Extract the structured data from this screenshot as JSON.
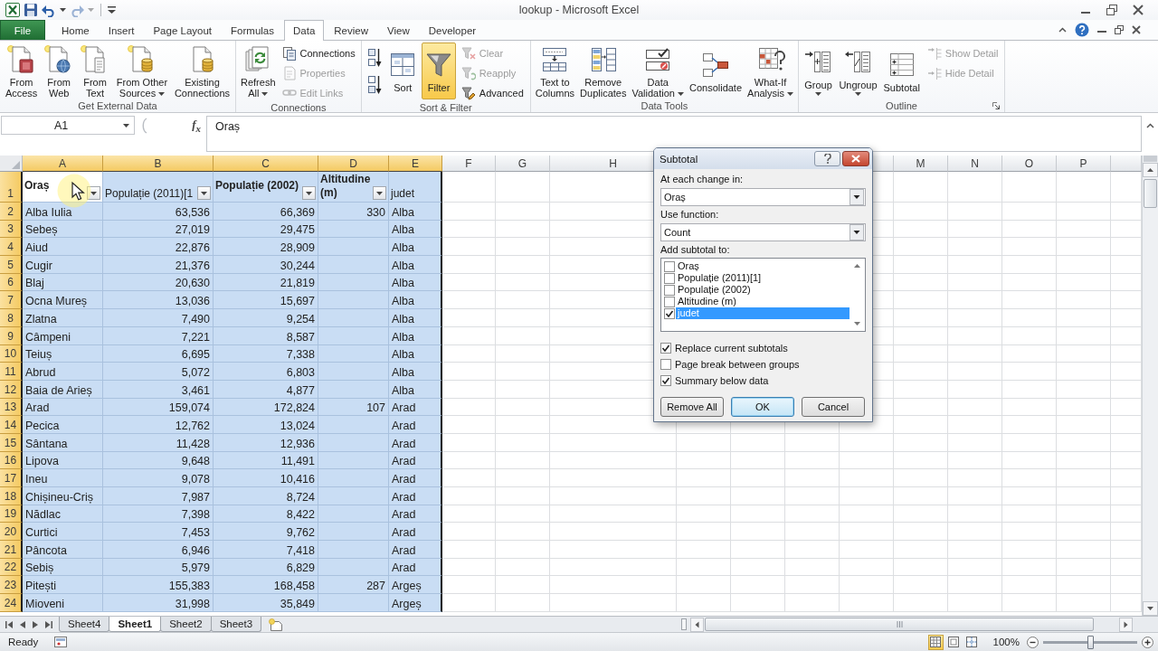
{
  "window": {
    "title": "lookup - Microsoft Excel"
  },
  "quick_access": [
    {
      "disabled": false
    },
    {
      "disabled": false
    },
    {
      "disabled": true
    }
  ],
  "ribbon_tabs": [
    {
      "label": "File",
      "kind": "file",
      "selected": false
    },
    {
      "label": "Home",
      "kind": "tab",
      "selected": false
    },
    {
      "label": "Insert",
      "kind": "tab",
      "selected": false
    },
    {
      "label": "Page Layout",
      "kind": "tab",
      "selected": false
    },
    {
      "label": "Formulas",
      "kind": "tab",
      "selected": false
    },
    {
      "label": "Data",
      "kind": "tab",
      "selected": true
    },
    {
      "label": "Review",
      "kind": "tab",
      "selected": false
    },
    {
      "label": "View",
      "kind": "tab",
      "selected": false
    },
    {
      "label": "Developer",
      "kind": "tab",
      "selected": false
    }
  ],
  "ribbon_groups": [
    {
      "label": "Get External Data",
      "launcher": false,
      "buttons": [
        {
          "kind": "large",
          "label": "From\nAccess",
          "dropdown": false,
          "disabled": false,
          "pressed": false
        },
        {
          "kind": "large",
          "label": "From\nWeb",
          "dropdown": false,
          "disabled": false,
          "pressed": false
        },
        {
          "kind": "large",
          "label": "From\nText",
          "dropdown": false,
          "disabled": false,
          "pressed": false
        },
        {
          "kind": "large",
          "label": "From Other\nSources",
          "dropdown": true,
          "disabled": false,
          "pressed": false
        },
        {
          "kind": "large",
          "label": "Existing\nConnections",
          "dropdown": false,
          "disabled": false,
          "pressed": false
        }
      ]
    },
    {
      "label": "Connections",
      "launcher": false,
      "buttons": [
        {
          "kind": "large",
          "label": "Refresh\nAll",
          "dropdown": true,
          "disabled": false,
          "pressed": false
        },
        {
          "kind": "small",
          "label": "Connections",
          "dropdown": false,
          "disabled": false,
          "pressed": false
        },
        {
          "kind": "small",
          "label": "Properties",
          "dropdown": false,
          "disabled": true,
          "pressed": false
        },
        {
          "kind": "small",
          "label": "Edit Links",
          "dropdown": false,
          "disabled": true,
          "pressed": false
        }
      ]
    },
    {
      "label": "Sort & Filter",
      "launcher": false,
      "buttons": [
        {
          "kind": "icon",
          "dropdown": false,
          "disabled": false,
          "pressed": false
        },
        {
          "kind": "icon",
          "dropdown": false,
          "disabled": false,
          "pressed": false
        },
        {
          "kind": "large",
          "label": "Sort",
          "dropdown": false,
          "disabled": false,
          "pressed": false
        },
        {
          "kind": "large",
          "label": "Filter",
          "dropdown": false,
          "disabled": false,
          "pressed": true
        },
        {
          "kind": "small",
          "label": "Clear",
          "dropdown": false,
          "disabled": true,
          "pressed": false
        },
        {
          "kind": "small",
          "label": "Reapply",
          "dropdown": false,
          "disabled": true,
          "pressed": false
        },
        {
          "kind": "small",
          "label": "Advanced",
          "dropdown": false,
          "disabled": false,
          "pressed": false
        }
      ]
    },
    {
      "label": "Data Tools",
      "launcher": false,
      "buttons": [
        {
          "kind": "large",
          "label": "Text to\nColumns",
          "dropdown": false,
          "disabled": false,
          "pressed": false
        },
        {
          "kind": "large",
          "label": "Remove\nDuplicates",
          "dropdown": false,
          "disabled": false,
          "pressed": false
        },
        {
          "kind": "large",
          "label": "Data\nValidation",
          "dropdown": true,
          "disabled": false,
          "pressed": false
        },
        {
          "kind": "large",
          "label": "Consolidate",
          "dropdown": false,
          "disabled": false,
          "pressed": false
        },
        {
          "kind": "large",
          "label": "What-If\nAnalysis",
          "dropdown": true,
          "disabled": false,
          "pressed": false
        }
      ]
    },
    {
      "label": "Outline",
      "launcher": true,
      "buttons": [
        {
          "kind": "large",
          "label": "Group",
          "dropdown": true,
          "disabled": false,
          "pressed": false
        },
        {
          "kind": "large",
          "label": "Ungroup",
          "dropdown": true,
          "disabled": false,
          "pressed": false
        },
        {
          "kind": "large",
          "label": "Subtotal",
          "dropdown": false,
          "disabled": false,
          "pressed": false
        },
        {
          "kind": "small",
          "label": "Show Detail",
          "dropdown": false,
          "disabled": true,
          "pressed": false
        },
        {
          "kind": "small",
          "label": "Hide Detail",
          "dropdown": false,
          "disabled": true,
          "pressed": false
        }
      ]
    }
  ],
  "formula_bar": {
    "name_box": "A1",
    "function_button": "f$_{x}$",
    "formula": "Oraș"
  },
  "sheet": {
    "columns": [
      {
        "letter": "A",
        "selected": true,
        "kind": "text"
      },
      {
        "letter": "B",
        "selected": true,
        "kind": "number"
      },
      {
        "letter": "C",
        "selected": true,
        "kind": "number"
      },
      {
        "letter": "D",
        "selected": true,
        "kind": "number"
      },
      {
        "letter": "E",
        "selected": true,
        "kind": "text"
      },
      {
        "letter": "F",
        "selected": false
      },
      {
        "letter": "G",
        "selected": false
      },
      {
        "letter": "H",
        "selected": false
      },
      {
        "selected": false
      },
      {
        "selected": false
      },
      {
        "selected": false
      },
      {
        "selected": false
      },
      {
        "letter": "M",
        "selected": false
      },
      {
        "letter": "N",
        "selected": false
      },
      {
        "letter": "O",
        "selected": false
      },
      {
        "letter": "P",
        "selected": false
      },
      {
        "selected": false
      }
    ],
    "header_row": {
      "number": "1",
      "selected": true,
      "cells": [
        {
          "text": "Oraș",
          "bold": true,
          "active": true,
          "filter": true
        },
        {
          "text": "Populație (2011)[1",
          "bold": false,
          "active": false,
          "filter": true
        },
        {
          "text": "Populație (2002)",
          "bold": true,
          "active": false,
          "filter": true
        },
        {
          "text": "Altitudine (m)",
          "bold": true,
          "active": false,
          "filter": true
        },
        {
          "text": "judet",
          "bold": false,
          "active": false,
          "filter": false
        }
      ]
    },
    "rows": [
      {
        "number": "2",
        "selected": true,
        "cells": [
          "Alba Iulia",
          "63,536",
          "66,369",
          "330",
          "Alba"
        ]
      },
      {
        "number": "3",
        "selected": true,
        "cells": [
          "Sebeș",
          "27,019",
          "29,475",
          null,
          "Alba"
        ]
      },
      {
        "number": "4",
        "selected": true,
        "cells": [
          "Aiud",
          "22,876",
          "28,909",
          null,
          "Alba"
        ]
      },
      {
        "number": "5",
        "selected": true,
        "cells": [
          "Cugir",
          "21,376",
          "30,244",
          null,
          "Alba"
        ]
      },
      {
        "number": "6",
        "selected": true,
        "cells": [
          "Blaj",
          "20,630",
          "21,819",
          null,
          "Alba"
        ]
      },
      {
        "number": "7",
        "selected": true,
        "cells": [
          "Ocna Mureș",
          "13,036",
          "15,697",
          null,
          "Alba"
        ]
      },
      {
        "number": "8",
        "selected": true,
        "cells": [
          "Zlatna",
          "7,490",
          "9,254",
          null,
          "Alba"
        ]
      },
      {
        "number": "9",
        "selected": true,
        "cells": [
          "Câmpeni",
          "7,221",
          "8,587",
          null,
          "Alba"
        ]
      },
      {
        "number": "10",
        "selected": true,
        "cells": [
          "Teiuș",
          "6,695",
          "7,338",
          null,
          "Alba"
        ]
      },
      {
        "number": "11",
        "selected": true,
        "cells": [
          "Abrud",
          "5,072",
          "6,803",
          null,
          "Alba"
        ]
      },
      {
        "number": "12",
        "selected": true,
        "cells": [
          "Baia de Arieș",
          "3,461",
          "4,877",
          null,
          "Alba"
        ]
      },
      {
        "number": "13",
        "selected": true,
        "cells": [
          "Arad",
          "159,074",
          "172,824",
          "107",
          "Arad"
        ]
      },
      {
        "number": "14",
        "selected": true,
        "cells": [
          "Pecica",
          "12,762",
          "13,024",
          null,
          "Arad"
        ]
      },
      {
        "number": "15",
        "selected": true,
        "cells": [
          "Sântana",
          "11,428",
          "12,936",
          null,
          "Arad"
        ]
      },
      {
        "number": "16",
        "selected": true,
        "cells": [
          "Lipova",
          "9,648",
          "11,491",
          null,
          "Arad"
        ]
      },
      {
        "number": "17",
        "selected": true,
        "cells": [
          "Ineu",
          "9,078",
          "10,416",
          null,
          "Arad"
        ]
      },
      {
        "number": "18",
        "selected": true,
        "cells": [
          "Chișineu-Criș",
          "7,987",
          "8,724",
          null,
          "Arad"
        ]
      },
      {
        "number": "19",
        "selected": true,
        "cells": [
          "Nădlac",
          "7,398",
          "8,422",
          null,
          "Arad"
        ]
      },
      {
        "number": "20",
        "selected": true,
        "cells": [
          "Curtici",
          "7,453",
          "9,762",
          null,
          "Arad"
        ]
      },
      {
        "number": "21",
        "selected": true,
        "cells": [
          "Pâncota",
          "6,946",
          "7,418",
          null,
          "Arad"
        ]
      },
      {
        "number": "22",
        "selected": true,
        "cells": [
          "Sebiș",
          "5,979",
          "6,829",
          null,
          "Arad"
        ]
      },
      {
        "number": "23",
        "selected": true,
        "cells": [
          "Pitești",
          "155,383",
          "168,458",
          "287",
          "Argeș"
        ]
      },
      {
        "number": "24",
        "selected": true,
        "cells": [
          "Mioveni",
          "31,998",
          "35,849",
          null,
          "Argeș"
        ]
      }
    ]
  },
  "dialog": {
    "title": "Subtotal",
    "fields": [
      {
        "label": "At each change in:",
        "value": "Oraș"
      },
      {
        "label": "Use function:",
        "value": "Count"
      }
    ],
    "list_label": "Add subtotal to:",
    "list_items": [
      {
        "label": "Oraș",
        "checked": false,
        "selected": false
      },
      {
        "label": "Populație (2011)[1]",
        "checked": false,
        "selected": false
      },
      {
        "label": "Populație (2002)",
        "checked": false,
        "selected": false
      },
      {
        "label": "Altitudine (m)",
        "checked": false,
        "selected": false
      },
      {
        "label": "judet",
        "checked": true,
        "selected": true
      }
    ],
    "options": [
      {
        "label": "Replace current subtotals",
        "checked": true
      },
      {
        "label": "Page break between groups",
        "checked": false
      },
      {
        "label": "Summary below data",
        "checked": true
      }
    ],
    "buttons": [
      {
        "label": "Remove All",
        "default": false
      },
      {
        "label": "OK",
        "default": true
      },
      {
        "label": "Cancel",
        "default": false
      }
    ]
  },
  "sheet_tabs": [
    {
      "label": "Sheet4",
      "selected": false
    },
    {
      "label": "Sheet1",
      "selected": true
    },
    {
      "label": "Sheet2",
      "selected": false
    },
    {
      "label": "Sheet3",
      "selected": false
    }
  ],
  "status_bar": {
    "text": "Ready",
    "views": [
      {
        "selected": true
      },
      {
        "selected": false
      },
      {
        "selected": false
      }
    ],
    "zoom": "100%",
    "zoom_slider": {
      "level": 0.5
    }
  }
}
